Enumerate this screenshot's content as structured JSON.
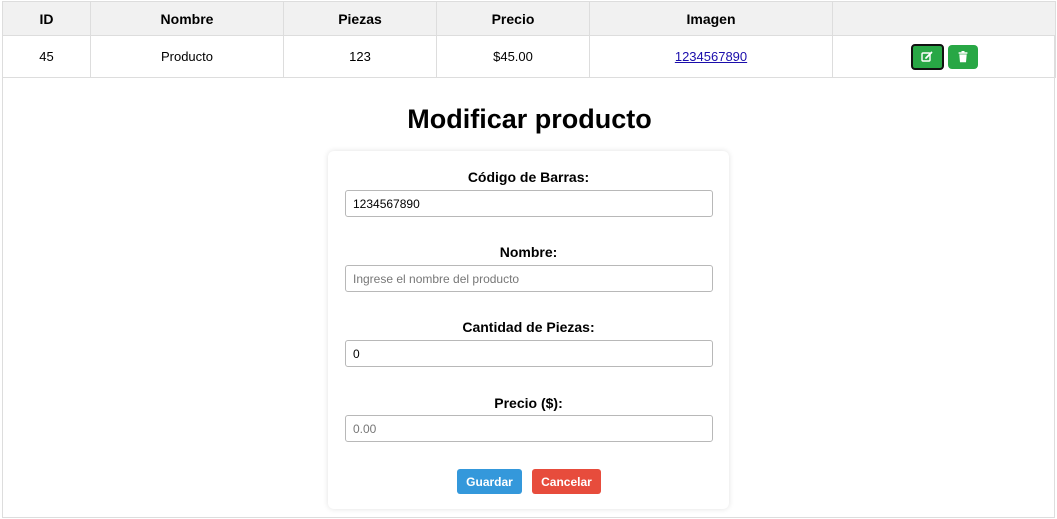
{
  "table": {
    "headers": [
      "ID",
      "Nombre",
      "Piezas",
      "Precio",
      "Imagen",
      ""
    ],
    "rows": [
      {
        "id": "45",
        "nombre": "Producto",
        "piezas": "123",
        "precio": "$45.00",
        "imagen": "1234567890",
        "actions": [
          "edit-icon",
          "trash-icon"
        ]
      }
    ]
  },
  "form": {
    "title": "Modificar producto",
    "barcode_label": "Código de Barras:",
    "barcode_value": "1234567890",
    "name_label": "Nombre:",
    "name_placeholder": "Ingrese el nombre del producto",
    "qty_label": "Cantidad de Piezas:",
    "qty_value": "0",
    "price_label": "Precio ($):",
    "price_placeholder": "0.00",
    "save_label": "Guardar",
    "cancel_label": "Cancelar"
  },
  "colors": {
    "action_green": "#28a745",
    "save_blue": "#3498db",
    "cancel_red": "#e74c3c",
    "header_bg": "#f1f1f1"
  }
}
